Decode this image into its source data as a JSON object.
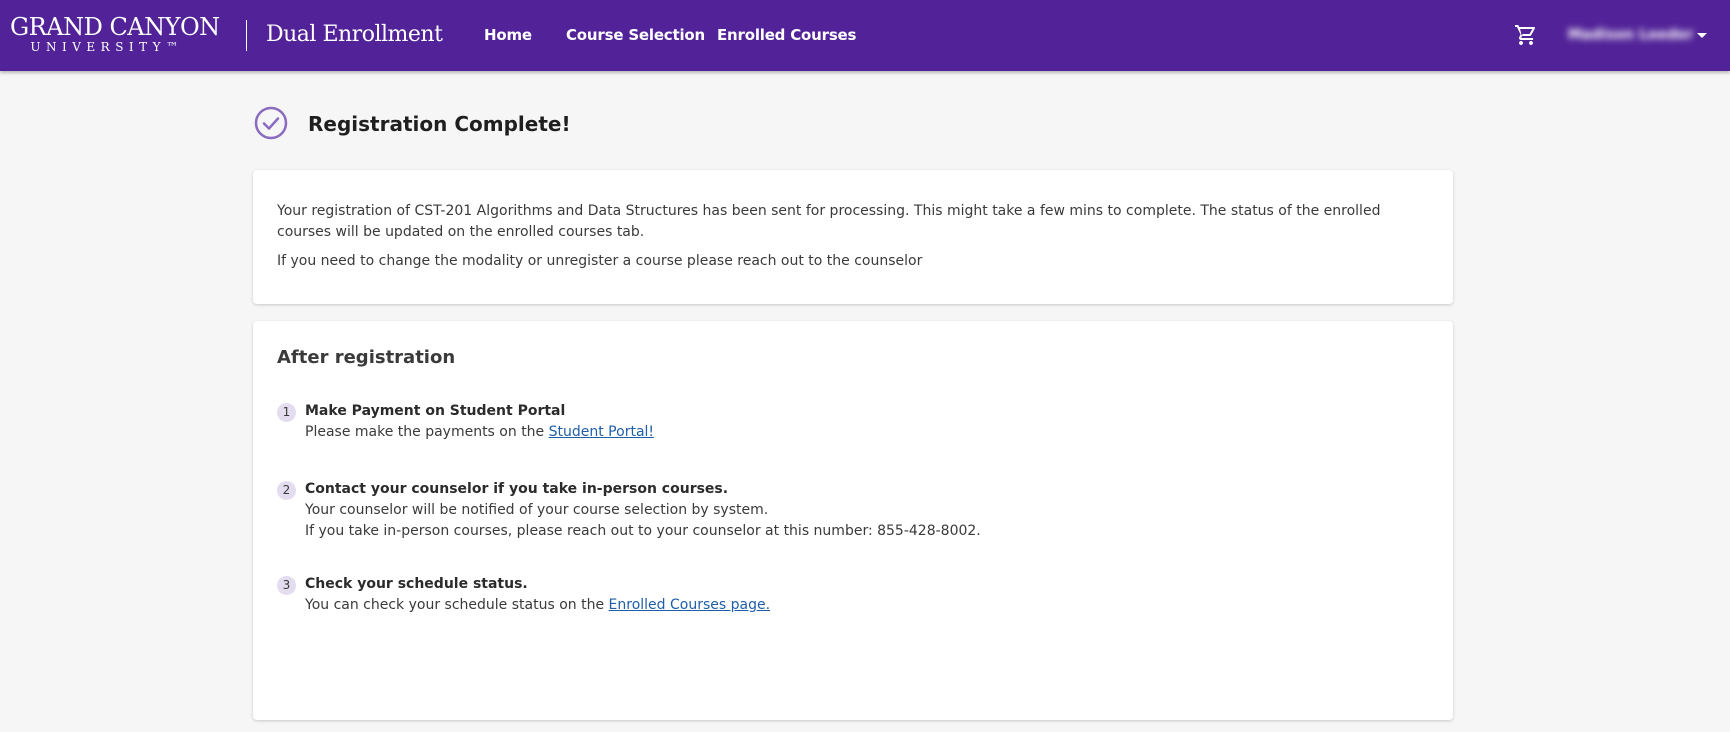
{
  "header": {
    "logo_line1": "GRAND CANYON",
    "logo_line2": "UNIVERSITY™",
    "product_name": "Dual Enrollment",
    "nav": [
      {
        "label": "Home"
      },
      {
        "label": "Course Selection"
      },
      {
        "label": "Enrolled Courses"
      }
    ],
    "user_name": "Madison Leeder",
    "icons": {
      "cart": "cart-icon",
      "menu": "caret-down-icon"
    }
  },
  "main": {
    "title": "Registration Complete!",
    "status_icon": "check-circle-icon",
    "message": {
      "line1": "Your registration of CST-201 Algorithms and Data Structures  has been sent for processing. This might take a few mins to complete. The status of the enrolled courses will be updated on the enrolled courses tab.",
      "line2": "If you need to change the modality or unregister a course please reach out to the counselor"
    },
    "after": {
      "title": "After registration",
      "steps": [
        {
          "number": "1",
          "title": "Make Payment on Student Portal",
          "text": "Please make the payments on the ",
          "link": "Student Portal!"
        },
        {
          "number": "2",
          "title": "Contact your counselor if you take in-person courses.",
          "text": "Your counselor will be notified of your course selection by system.",
          "text2": "If you take in-person courses, please reach out to your counselor at this number: 855-428-8002."
        },
        {
          "number": "3",
          "title": "Check your schedule status.",
          "text": "You can check your schedule status on the ",
          "link": "Enrolled Courses page."
        }
      ]
    }
  },
  "colors": {
    "brand_purple": "#522398",
    "link_blue": "#1f5ea8",
    "step_badge": "#e4dcef"
  }
}
